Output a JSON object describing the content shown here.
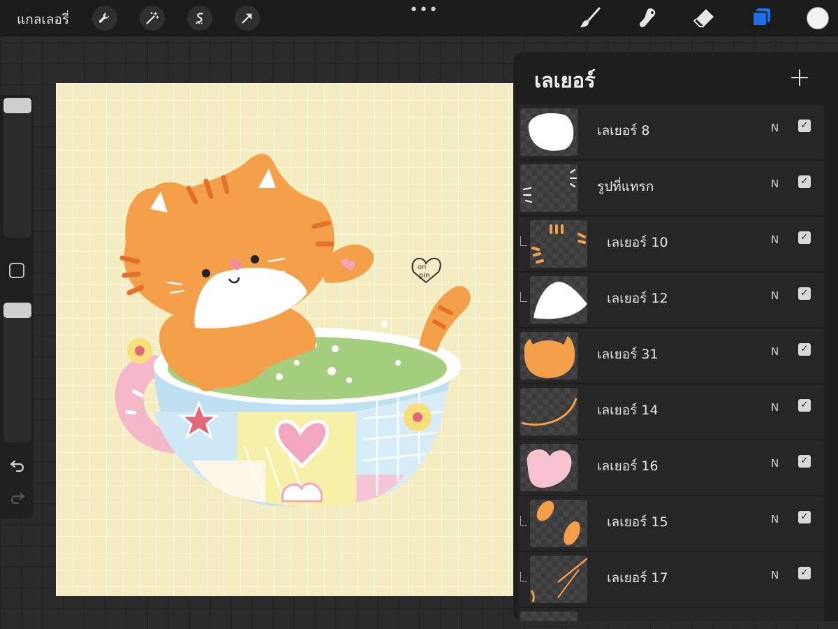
{
  "topbar": {
    "gallery_label": "แกลเลอรี่",
    "more_label": "•••",
    "tools_left": [
      "wrench-icon",
      "magic-wand-icon",
      "selection-icon",
      "transform-arrow-icon"
    ],
    "tools_right": [
      "brush-icon",
      "smudge-icon",
      "eraser-icon",
      "layers-icon"
    ],
    "active_color": "#f2f2f2",
    "layers_accent": "#1f6fe5"
  },
  "sidebar": {
    "brush_size_level": 0.0,
    "opacity_level": 0.0,
    "modify_icon": "square-icon",
    "undo_icon": "undo-icon",
    "redo_icon": "redo-icon"
  },
  "canvas": {
    "background_color": "#f5edc2",
    "signature_text": "on pin"
  },
  "layers": {
    "title": "เลเยอร์",
    "add_icon": "plus-icon",
    "items": [
      {
        "name": "เลเยอร์ 8",
        "blend": "N",
        "visible": true,
        "clipped": false
      },
      {
        "name": "รูปที่แทรก",
        "blend": "N",
        "visible": true,
        "clipped": false
      },
      {
        "name": "เลเยอร์ 10",
        "blend": "N",
        "visible": true,
        "clipped": true
      },
      {
        "name": "เลเยอร์ 12",
        "blend": "N",
        "visible": true,
        "clipped": true
      },
      {
        "name": "เลเยอร์ 31",
        "blend": "N",
        "visible": true,
        "clipped": false
      },
      {
        "name": "เลเยอร์ 14",
        "blend": "N",
        "visible": true,
        "clipped": false
      },
      {
        "name": "เลเยอร์ 16",
        "blend": "N",
        "visible": true,
        "clipped": false
      },
      {
        "name": "เลเยอร์ 15",
        "blend": "N",
        "visible": true,
        "clipped": true
      },
      {
        "name": "เลเยอร์ 17",
        "blend": "N",
        "visible": true,
        "clipped": true
      }
    ]
  }
}
